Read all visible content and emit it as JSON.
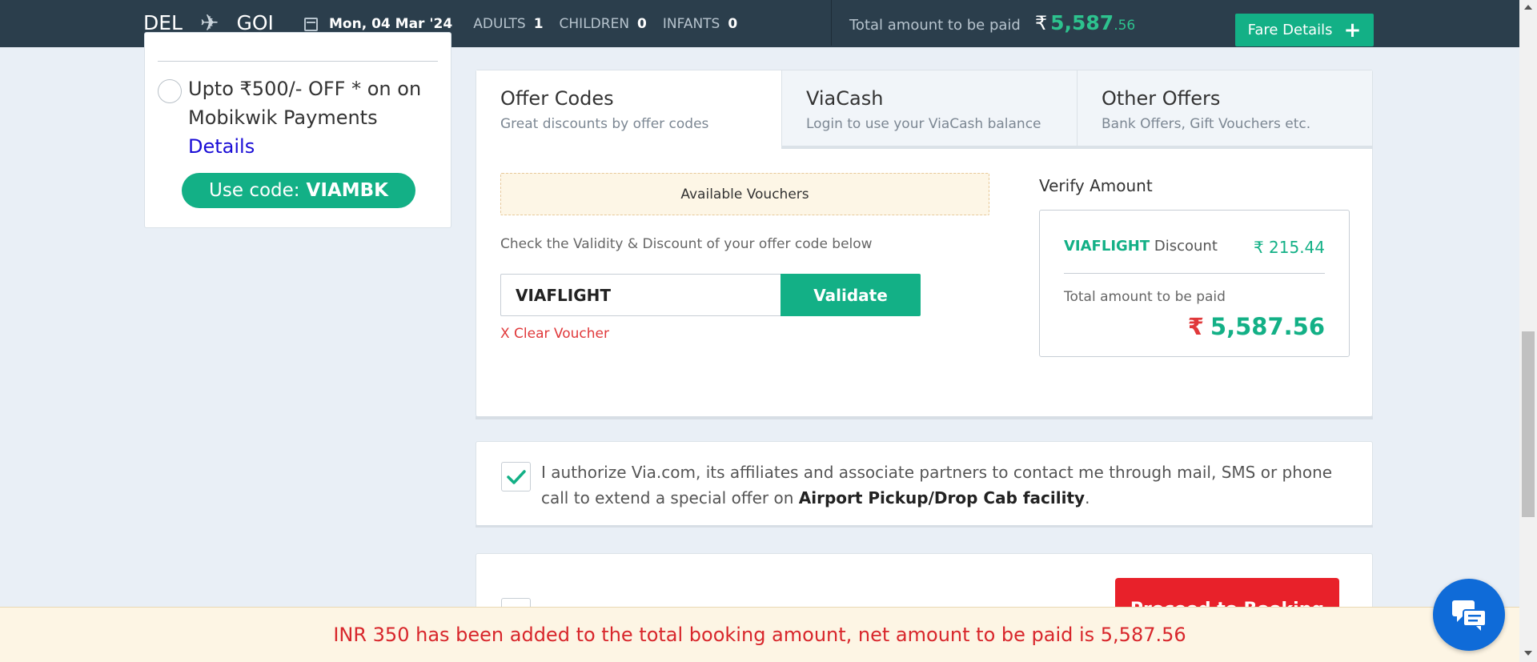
{
  "header": {
    "from": "DEL",
    "to": "GOI",
    "plane_icon": "airplane-icon",
    "date": "Mon, 04 Mar '24",
    "adults_label": "ADULTS",
    "adults": "1",
    "children_label": "CHILDREN",
    "children": "0",
    "infants_label": "INFANTS",
    "infants": "0",
    "total_label": "Total amount to be paid",
    "currency": "₹",
    "total_amount": "5,587",
    "total_decimal": ".56",
    "fare_details_label": "Fare Details",
    "fare_details_icon": "+"
  },
  "left_offer": {
    "text": "Upto ₹500/- OFF * on on Mobikwik Payments",
    "details_link": "Details",
    "use_code_label": "Use code:",
    "code": "VIAMBK"
  },
  "tabs": [
    {
      "title": "Offer Codes",
      "subtitle": "Great discounts by offer codes",
      "active": true
    },
    {
      "title": "ViaCash",
      "subtitle": "Login to use your ViaCash balance",
      "active": false
    },
    {
      "title": "Other Offers",
      "subtitle": "Bank Offers, Gift Vouchers etc.",
      "active": false
    }
  ],
  "offer_codes": {
    "available_vouchers": "Available Vouchers",
    "check_text": "Check the Validity & Discount of your offer code below",
    "input_value": "VIAFLIGHT",
    "validate_label": "Validate",
    "clear_label": "X Clear Voucher"
  },
  "verify": {
    "title": "Verify Amount",
    "code": "VIAFLIGHT",
    "discount_label": "Discount",
    "discount_value": "₹ 215.44",
    "total_label": "Total amount to be paid",
    "currency": "₹",
    "total_value": "5,587.56"
  },
  "consent": {
    "text_before": "I authorize Via.com, its affiliates and associate partners to contact me through mail, SMS or phone call to extend a special offer on ",
    "text_bold": "Airport Pickup/Drop Cab facility",
    "text_after": ".",
    "checked": true
  },
  "proceed": {
    "label": "Proceed to Booking"
  },
  "banner": {
    "text": "INR 350 has been added to the total booking amount, net amount to be paid is 5,587.56"
  },
  "colors": {
    "header_bg": "#2b3e4c",
    "accent_green": "#13b086",
    "alert_red": "#d8262b",
    "chat_blue": "#0f6bd8"
  }
}
